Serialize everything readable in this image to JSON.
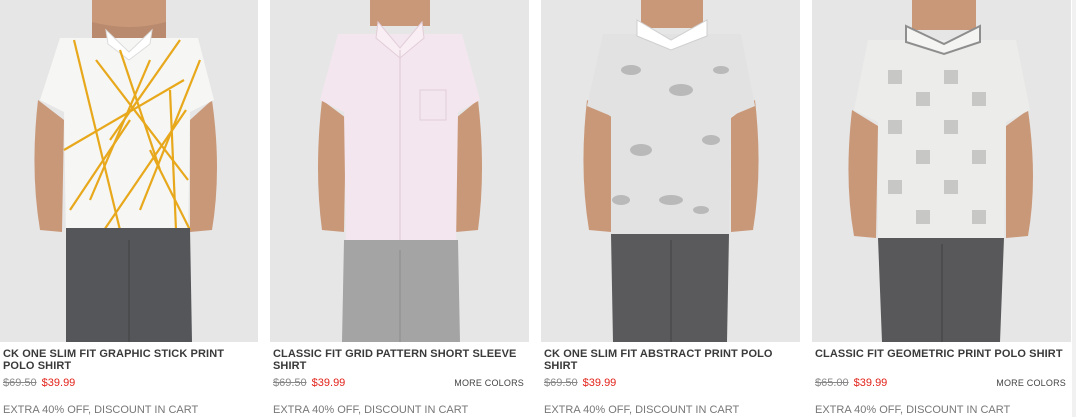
{
  "products": [
    {
      "name": "CK ONE SLIM FIT GRAPHIC STICK PRINT POLO SHIRT",
      "price_original": "$69.50",
      "price_sale": "$39.99",
      "more_colors": "",
      "promo": "EXTRA 40% OFF, DISCOUNT IN CART",
      "shirt_color": "#f6f6f4",
      "accent_color": "#e8a81c",
      "pants_color": "#55565a"
    },
    {
      "name": "CLASSIC FIT GRID PATTERN SHORT SLEEVE SHIRT",
      "price_original": "$69.50",
      "price_sale": "$39.99",
      "more_colors": "MORE COLORS",
      "promo": "EXTRA 40% OFF, DISCOUNT IN CART",
      "shirt_color": "#f3e6ee",
      "accent_color": "#e7c9d8",
      "pants_color": "#a4a4a4"
    },
    {
      "name": "CK ONE SLIM FIT ABSTRACT PRINT POLO SHIRT",
      "price_original": "$69.50",
      "price_sale": "$39.99",
      "more_colors": "",
      "promo": "EXTRA 40% OFF, DISCOUNT IN CART",
      "shirt_color": "#e2e2e2",
      "accent_color": "#b9b9b9",
      "pants_color": "#5a5a5c"
    },
    {
      "name": "CLASSIC FIT GEOMETRIC PRINT POLO SHIRT",
      "price_original": "$65.00",
      "price_sale": "$39.99",
      "more_colors": "MORE COLORS",
      "promo": "EXTRA 40% OFF, DISCOUNT IN CART",
      "shirt_color": "#ececea",
      "accent_color": "#c7c7c5",
      "pants_color": "#58585a"
    }
  ],
  "colors": {
    "sale_price": "#e2231a",
    "photo_background": "#e4e4e4",
    "skin": "#c99879"
  }
}
